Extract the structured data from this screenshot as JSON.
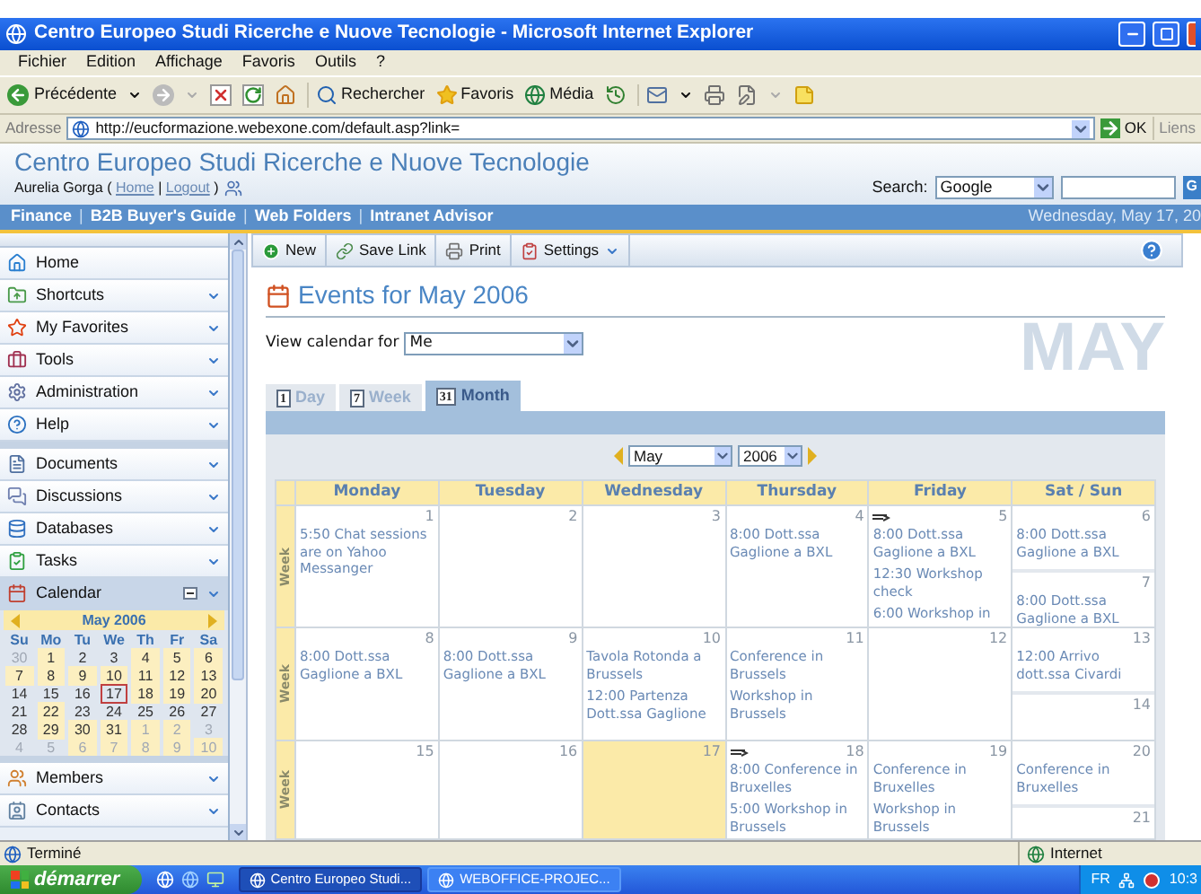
{
  "window": {
    "title": "Centro Europeo Studi Ricerche e Nuove Tecnologie - Microsoft Internet Explorer"
  },
  "menu": [
    "Fichier",
    "Edition",
    "Affichage",
    "Favoris",
    "Outils",
    "?"
  ],
  "toolbar": [
    "Précédente",
    "Rechercher",
    "Favoris",
    "Média"
  ],
  "address": {
    "label": "Adresse",
    "url": "http://eucformazione.webexone.com/default.asp?link=",
    "go": "OK",
    "links": "Liens"
  },
  "site": {
    "title": "Centro Europeo Studi Ricerche e Nuove Tecnologie",
    "user": {
      "name": "Aurelia Gorga",
      "open": "(",
      "links": [
        "Home",
        "Logout"
      ],
      "separator": "|",
      "close": ")"
    },
    "search": {
      "label": "Search:",
      "engine": "Google",
      "button": "G"
    }
  },
  "nav": {
    "links": [
      "Finance",
      "B2B Buyer's Guide",
      "Web Folders",
      "Intranet Advisor"
    ],
    "separator": "|",
    "date": "Wednesday, May 17, 20"
  },
  "sidebar": {
    "sections": [
      [
        {
          "label": "Home",
          "kind": "link",
          "expanded": false
        },
        {
          "label": "Shortcuts",
          "kind": "menu",
          "expanded": false
        },
        {
          "label": "My Favorites",
          "kind": "menu",
          "expanded": false
        },
        {
          "label": "Tools",
          "kind": "menu",
          "expanded": false
        },
        {
          "label": "Administration",
          "kind": "menu",
          "expanded": false
        },
        {
          "label": "Help",
          "kind": "menu",
          "expanded": false
        }
      ],
      [
        {
          "label": "Documents",
          "kind": "menu",
          "expanded": false
        },
        {
          "label": "Discussions",
          "kind": "menu",
          "expanded": false
        },
        {
          "label": "Databases",
          "kind": "menu",
          "expanded": false
        },
        {
          "label": "Tasks",
          "kind": "menu",
          "expanded": false
        },
        {
          "label": "Calendar",
          "kind": "menu",
          "expanded": true
        }
      ],
      [
        {
          "label": "Members",
          "kind": "menu",
          "expanded": false
        },
        {
          "label": "Contacts",
          "kind": "menu",
          "expanded": false
        }
      ]
    ]
  },
  "mini_calendar": {
    "title": "May 2006",
    "weekdays": [
      "Su",
      "Mo",
      "Tu",
      "We",
      "Th",
      "Fr",
      "Sa"
    ],
    "weeks": [
      [
        {
          "day": "30",
          "events": false,
          "muted": true,
          "today": false
        },
        {
          "day": "1",
          "events": true,
          "muted": false,
          "today": false
        },
        {
          "day": "2",
          "events": false,
          "muted": false,
          "today": false
        },
        {
          "day": "3",
          "events": false,
          "muted": false,
          "today": false
        },
        {
          "day": "4",
          "events": true,
          "muted": false,
          "today": false
        },
        {
          "day": "5",
          "events": true,
          "muted": false,
          "today": false
        },
        {
          "day": "6",
          "events": true,
          "muted": false,
          "today": false
        }
      ],
      [
        {
          "day": "7",
          "events": true,
          "muted": false,
          "today": false
        },
        {
          "day": "8",
          "events": true,
          "muted": false,
          "today": false
        },
        {
          "day": "9",
          "events": true,
          "muted": false,
          "today": false
        },
        {
          "day": "10",
          "events": true,
          "muted": false,
          "today": false
        },
        {
          "day": "11",
          "events": true,
          "muted": false,
          "today": false
        },
        {
          "day": "12",
          "events": true,
          "muted": false,
          "today": false
        },
        {
          "day": "13",
          "events": true,
          "muted": false,
          "today": false
        }
      ],
      [
        {
          "day": "14",
          "events": false,
          "muted": false,
          "today": false
        },
        {
          "day": "15",
          "events": false,
          "muted": false,
          "today": false
        },
        {
          "day": "16",
          "events": false,
          "muted": false,
          "today": false
        },
        {
          "day": "17",
          "events": false,
          "muted": false,
          "today": true
        },
        {
          "day": "18",
          "events": true,
          "muted": false,
          "today": false
        },
        {
          "day": "19",
          "events": true,
          "muted": false,
          "today": false
        },
        {
          "day": "20",
          "events": true,
          "muted": false,
          "today": false
        }
      ],
      [
        {
          "day": "21",
          "events": false,
          "muted": false,
          "today": false
        },
        {
          "day": "22",
          "events": true,
          "muted": false,
          "today": false
        },
        {
          "day": "23",
          "events": false,
          "muted": false,
          "today": false
        },
        {
          "day": "24",
          "events": false,
          "muted": false,
          "today": false
        },
        {
          "day": "25",
          "events": false,
          "muted": false,
          "today": false
        },
        {
          "day": "26",
          "events": false,
          "muted": false,
          "today": false
        },
        {
          "day": "27",
          "events": false,
          "muted": false,
          "today": false
        }
      ],
      [
        {
          "day": "28",
          "events": false,
          "muted": false,
          "today": false
        },
        {
          "day": "29",
          "events": true,
          "muted": false,
          "today": false
        },
        {
          "day": "30",
          "events": true,
          "muted": false,
          "today": false
        },
        {
          "day": "31",
          "events": true,
          "muted": false,
          "today": false
        },
        {
          "day": "1",
          "events": true,
          "muted": true,
          "today": false
        },
        {
          "day": "2",
          "events": true,
          "muted": true,
          "today": false
        },
        {
          "day": "3",
          "events": false,
          "muted": true,
          "today": false
        }
      ],
      [
        {
          "day": "4",
          "events": false,
          "muted": true,
          "today": false
        },
        {
          "day": "5",
          "events": false,
          "muted": true,
          "today": false
        },
        {
          "day": "6",
          "events": true,
          "muted": true,
          "today": false
        },
        {
          "day": "7",
          "events": true,
          "muted": true,
          "today": false
        },
        {
          "day": "8",
          "events": true,
          "muted": true,
          "today": false
        },
        {
          "day": "9",
          "events": true,
          "muted": true,
          "today": false
        },
        {
          "day": "10",
          "events": true,
          "muted": true,
          "today": false
        }
      ]
    ]
  },
  "page_toolbar": [
    "New",
    "Save Link",
    "Print",
    "Settings"
  ],
  "page": {
    "title": "Events for May 2006",
    "view_label": "View calendar for",
    "view_value": "Me",
    "banner": "MAY",
    "tabs": [
      {
        "label": "Day",
        "badge": "1",
        "selected": false
      },
      {
        "label": "Week",
        "badge": "7",
        "selected": false
      },
      {
        "label": "Month",
        "badge": "31",
        "selected": true
      }
    ],
    "month": "May",
    "year": "2006",
    "columns": [
      "Monday",
      "Tuesday",
      "Wednesday",
      "Thursday",
      "Friday",
      "Sat / Sun"
    ],
    "weeks": [
      {
        "label": "Week",
        "days": [
          {
            "day": "1",
            "today": false,
            "flagged": false,
            "events": [
              "5:50 Chat sessions are on Yahoo Messanger"
            ]
          },
          {
            "day": "2",
            "today": false,
            "flagged": false
          },
          {
            "day": "3",
            "today": false,
            "flagged": false
          },
          {
            "day": "4",
            "today": false,
            "flagged": false,
            "events": [
              "8:00 Dott.ssa Gaglione a BXL"
            ]
          },
          {
            "day": "5",
            "today": false,
            "flagged": true,
            "events": [
              "8:00 Dott.ssa Gaglione a BXL",
              "12:30 Workshop check",
              "6:00 Workshop in"
            ]
          },
          {
            "day": "6",
            "today": false,
            "flagged": false,
            "events": [
              "8:00 Dott.ssa Gaglione a BXL"
            ]
          },
          {
            "day": "7",
            "today": false,
            "flagged": false,
            "events": [
              "8:00 Dott.ssa Gaglione a BXL"
            ]
          }
        ]
      },
      {
        "label": "Week",
        "days": [
          {
            "day": "8",
            "today": false,
            "flagged": false,
            "events": [
              "8:00 Dott.ssa Gaglione a BXL"
            ]
          },
          {
            "day": "9",
            "today": false,
            "flagged": false,
            "events": [
              "8:00 Dott.ssa Gaglione a BXL"
            ]
          },
          {
            "day": "10",
            "today": false,
            "flagged": false,
            "events": [
              "Tavola Rotonda a Brussels",
              "12:00 Partenza Dott.ssa Gaglione"
            ]
          },
          {
            "day": "11",
            "today": false,
            "flagged": false,
            "events": [
              "Conference in Brussels",
              "Workshop in Brussels"
            ]
          },
          {
            "day": "12",
            "today": false,
            "flagged": false
          },
          {
            "day": "13",
            "today": false,
            "flagged": false,
            "events": [
              "12:00 Arrivo dott.ssa Civardi"
            ]
          },
          {
            "day": "14",
            "today": false,
            "flagged": false
          }
        ]
      },
      {
        "label": "Week",
        "days": [
          {
            "day": "15",
            "today": false,
            "flagged": false
          },
          {
            "day": "16",
            "today": false,
            "flagged": false
          },
          {
            "day": "17",
            "today": true,
            "flagged": false
          },
          {
            "day": "18",
            "today": false,
            "flagged": true,
            "events": [
              "8:00 Conference in Bruxelles",
              "5:00 Workshop in Brussels"
            ]
          },
          {
            "day": "19",
            "today": false,
            "flagged": false,
            "events": [
              "Conference in Bruxelles",
              "Workshop in Brussels"
            ]
          },
          {
            "day": "20",
            "today": false,
            "flagged": false,
            "events": [
              "Conference in Bruxelles"
            ]
          },
          {
            "day": "21",
            "today": false,
            "flagged": false
          }
        ]
      }
    ]
  },
  "status_bar": {
    "text": "Terminé",
    "zone": "Internet"
  },
  "taskbar": {
    "start": "démarrer",
    "tasks": [
      {
        "label": "Centro Europeo Studi...",
        "selected": true
      },
      {
        "label": "WEBOFFICE-PROJEC...",
        "selected": false
      }
    ],
    "language": "FR",
    "clock": "10:3"
  }
}
